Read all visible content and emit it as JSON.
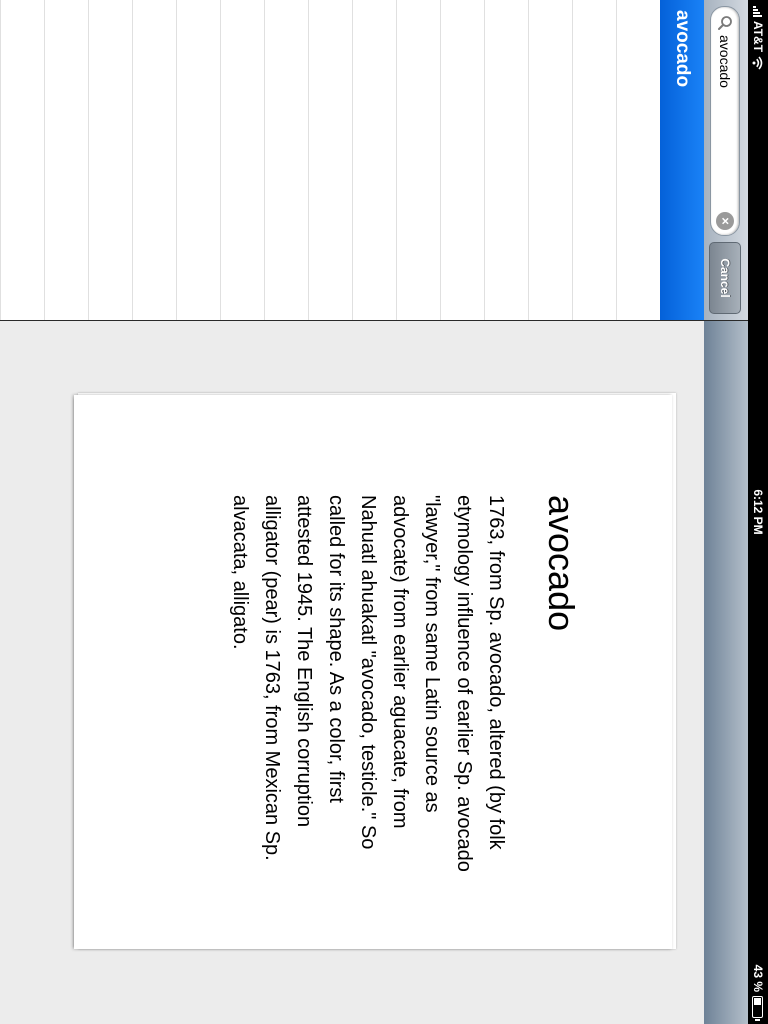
{
  "status_bar": {
    "carrier": "AT&T",
    "time": "6:12 PM",
    "battery_percent": "43 %",
    "battery_level": 0.43
  },
  "sidebar": {
    "search": {
      "value": "avocado",
      "placeholder": "",
      "cancel_label": "Cancel"
    },
    "results": [
      {
        "label": "avocado",
        "selected": true
      }
    ]
  },
  "detail": {
    "title": "avocado",
    "body": "1763, from Sp. avocado, altered (by folk etymology influence of earlier Sp. avocado \"lawyer,\" from same Latin source as advocate) from earlier aguacate, from Nahuatl ahuakatl \"avocado, testicle.\" So called for its shape. As a color, first attested 1945. The English corruption alligator (pear) is 1763, from Mexican Sp. alvacata, alligato."
  },
  "colors": {
    "selection_blue": "#0461d9",
    "nav_bar": "#6e8297",
    "page_background": "#ececec"
  }
}
